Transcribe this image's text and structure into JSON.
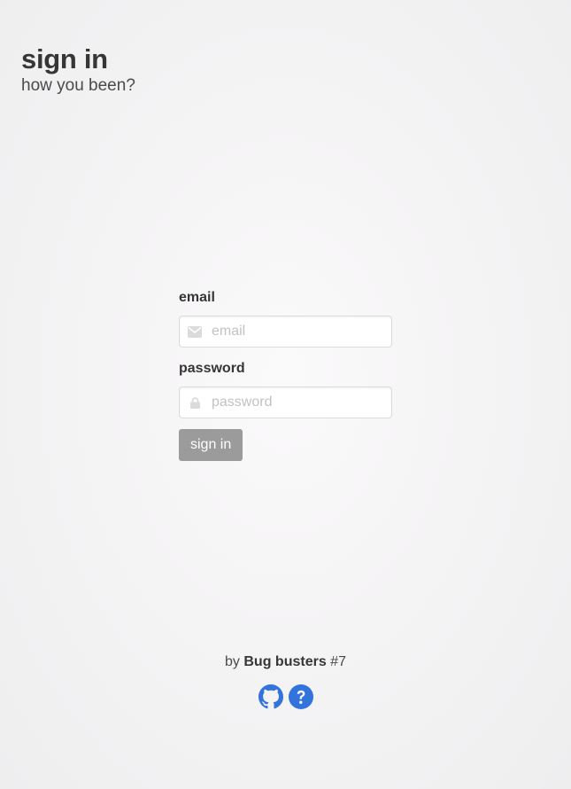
{
  "header": {
    "title": "sign in",
    "subtitle": "how you been?"
  },
  "form": {
    "email_label": "email",
    "email_placeholder": "email",
    "email_value": "",
    "password_label": "password",
    "password_placeholder": "password",
    "password_value": "",
    "submit_label": "sign in"
  },
  "footer": {
    "by": "by",
    "team_name": "Bug busters",
    "team_number": "#7",
    "links": [
      {
        "icon": "github-icon"
      },
      {
        "icon": "help-circle-icon"
      }
    ]
  },
  "colors": {
    "accent": "#3273dc",
    "button_disabled": "#9b9b9b",
    "icon_muted": "#dbdbdb",
    "text": "#363636"
  }
}
